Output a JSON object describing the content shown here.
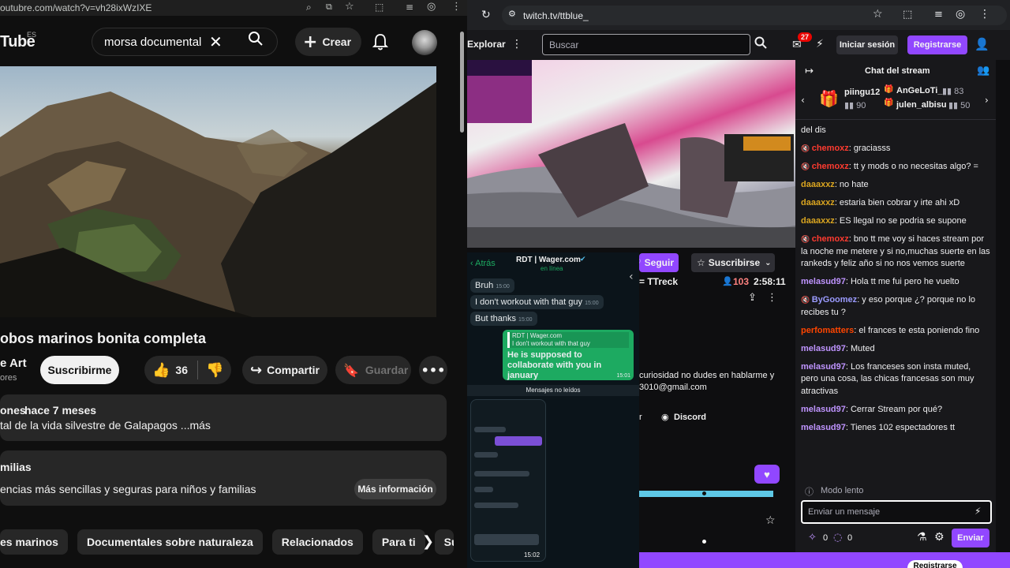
{
  "left": {
    "url": "outubre.com/watch?v=vh28ixWzIXE",
    "logo": "Tube",
    "logo_country": "ES",
    "search_value": "morsa documental",
    "create_label": "Crear",
    "video_title": "obos marinos bonita completa",
    "channel_name": "e Art",
    "channel_sub": "ores",
    "subscribe_label": "Suscribirme",
    "likes": "36",
    "share_label": "Compartir",
    "save_label": "Guardar",
    "desc_meta_prefix": "ones",
    "desc_meta_date": "hace 7 meses",
    "desc_text": "tal de la vida silvestre de Galapagos ...más",
    "promo_title": "milias",
    "promo_text": "encias más sencillas y seguras para niños y familias",
    "promo_button": "Más información",
    "chips": [
      "es marinos",
      "Documentales sobre naturaleza",
      "Relacionados",
      "Para ti",
      "Subid"
    ]
  },
  "right": {
    "url": "twitch.tv/ttblue_",
    "explore": "Explorar",
    "search_placeholder": "Buscar",
    "notif_count": "27",
    "login_label": "Iniciar sesión",
    "register_label": "Registrarse",
    "follow_label": "Seguir",
    "subscribe_label": "Suscribirse",
    "streamer": "= TTreck",
    "viewers": "103",
    "uptime": "2:58:11",
    "about_text": "curiosidad no dudes en hablarme y",
    "about_email": "3010@gmail.com",
    "social_r": "r",
    "discord_label": "Discord",
    "chat_title": "Chat del stream",
    "gifters": [
      {
        "name": "piingu12",
        "count": "90"
      },
      {
        "name": "AnGeLoTi_",
        "count": "83"
      },
      {
        "name": "julen_albisu",
        "count": "50"
      }
    ],
    "messages": [
      {
        "user": "",
        "text": "del dis",
        "color": "#efeff1",
        "icon": false
      },
      {
        "user": "chemoxz",
        "text": ": graciasss",
        "color": "#ff3b30",
        "icon": true
      },
      {
        "user": "chemoxz",
        "text": ": tt y mods o no necesitas algo? =",
        "color": "#ff3b30",
        "icon": true
      },
      {
        "user": "daaaxxz",
        "text": ": no hate",
        "color": "#daa520",
        "icon": false
      },
      {
        "user": "daaaxxz",
        "text": ": estaria bien cobrar y irte ahi xD",
        "color": "#daa520",
        "icon": false
      },
      {
        "user": "daaaxxz",
        "text": ": ES llegal no se podria se supone",
        "color": "#daa520",
        "icon": false
      },
      {
        "user": "chemoxz",
        "text": ": bno tt me voy si haces stream por la noche me metere y si no,muchas suerte en las rankeds y feliz año si no nos vemos suerte",
        "color": "#ff3b30",
        "icon": true
      },
      {
        "user": "melasud97",
        "text": ": Hola tt me fui pero he vuelto",
        "color": "#bf94ff",
        "icon": false
      },
      {
        "user": "ByGoomez",
        "text": ": y eso porque ¿? porque no lo recibes tu ?",
        "color": "#9b9bff",
        "icon": true
      },
      {
        "user": "perfomatters",
        "text": ": el frances te esta poniendo fino",
        "color": "#ff4500",
        "icon": false
      },
      {
        "user": "melasud97",
        "text": ": Muted",
        "color": "#bf94ff",
        "icon": false
      },
      {
        "user": "melasud97",
        "text": ": Los franceses son insta muted, pero una cosa, las chicas francesas son muy atractivas",
        "color": "#bf94ff",
        "icon": false
      },
      {
        "user": "melasud97",
        "text": ": Cerrar Stream por qué?",
        "color": "#bf94ff",
        "icon": false
      },
      {
        "user": "melasud97",
        "text": ": Tienes 102 espectadores tt",
        "color": "#bf94ff",
        "icon": false
      }
    ],
    "slow_mode": "Modo lento",
    "chat_placeholder": "Enviar un mensaje",
    "points_a": "0",
    "points_b": "0",
    "send_label": "Enviar",
    "bottom_register": "Registrarse",
    "wa": {
      "back": "Atrás",
      "contact": "RDT | Wager.com",
      "status": "en línea",
      "msgs": [
        {
          "text": "Bruh",
          "time": "15:00"
        },
        {
          "text": "I don't workout with that guy",
          "time": "15:00"
        },
        {
          "text": "But thanks",
          "time": "15:00"
        }
      ],
      "reply_quote_name": "RDT | Wager.com",
      "reply_quote_text": "I don't workout with that guy",
      "reply_text": "He is supposed to collaborate with you in january",
      "reply_time": "15:01",
      "unread": "Mensajes no leídos",
      "phone_time": "15:02"
    }
  },
  "colors": {
    "twitch_purple": "#9147ff",
    "yt_bg": "#0f0f0f",
    "wa_green": "#1daa61"
  }
}
